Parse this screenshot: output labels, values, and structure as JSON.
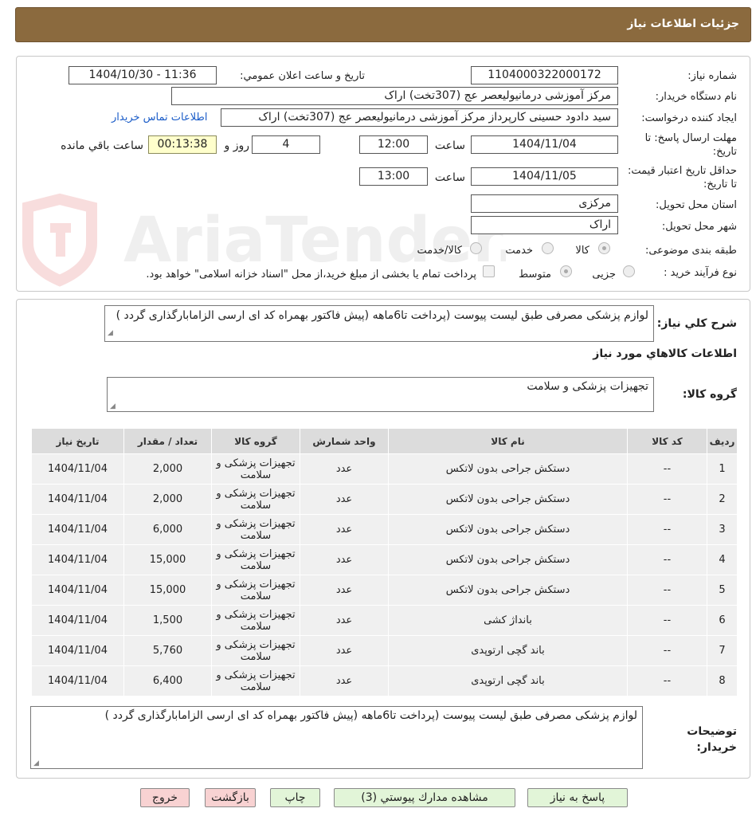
{
  "header": {
    "title": "جزئیات اطلاعات نیاز"
  },
  "form": {
    "need_number_label": "شماره نیاز:",
    "need_number": "1104000322000172",
    "announce_label": "تاریخ و ساعت اعلان عمومي:",
    "announce_value": "1404/10/30 - 11:36",
    "buyer_org_label": "نام دستگاه خریدار:",
    "buyer_org": "مرکز آموزشی درمانیولیعصر عج (307تخت) اراک",
    "requester_label": "ایجاد کننده درخواست:",
    "requester": "سید دادود حسینی کارپرداز مرکز آموزشی درمانیولیعصر عج (307تخت) اراک",
    "contact_link": "اطلاعات تماس خریدار",
    "deadline_label": "مهلت ارسال پاسخ: تا تاریخ:",
    "deadline_date": "1404/11/04",
    "time_label": "ساعت",
    "deadline_time": "12:00",
    "days_value": "4",
    "days_label": "روز و",
    "remaining_time": "00:13:38",
    "remaining_label": "ساعت باقي مانده",
    "validity_label": "حداقل تاریخ اعتبار قیمت: تا تاریخ:",
    "validity_date": "1404/11/05",
    "validity_time": "13:00",
    "province_label": "استان محل تحویل:",
    "province": "مرکزی",
    "city_label": "شهر محل تحویل:",
    "city": "اراک",
    "category_label": "طبقه بندی موضوعی:",
    "category_options": [
      "کالا",
      "خدمت",
      "کالا/خدمت"
    ],
    "process_label": "نوع فرآیند خرید :",
    "process_options": [
      "جزیی",
      "متوسط"
    ],
    "payment_note": "پرداخت تمام یا بخشی از مبلغ خرید،از محل \"اسناد خزانه اسلامی\" خواهد بود."
  },
  "details": {
    "summary_label": "شرح کلي نیاز:",
    "summary": "لوازم پزشکی مصرفی طبق لیست پیوست (پرداخت تا6ماهه (پیش فاکتور بهمراه کد ای ارسی الزامابارگذاری گردد )",
    "goods_info_title": "اطلاعات کالاهاي مورد نیاز",
    "goods_group_label": "گروه کالا:",
    "goods_group": "تجهیزات پزشکی و سلامت",
    "buyer_notes_label": "توضیحات خریدار:",
    "buyer_notes": "لوازم پزشکی مصرفی طبق لیست پیوست (پرداخت تا6ماهه (پیش فاکتور بهمراه کد ای ارسی الزامابارگذاری گردد )"
  },
  "table": {
    "columns": [
      "ردیف",
      "کد کالا",
      "نام کالا",
      "واحد شمارش",
      "گروه کالا",
      "تعداد / مقدار",
      "تاریخ نیاز"
    ],
    "rows": [
      [
        "1",
        "--",
        "دستکش جراحی بدون لاتکس",
        "عدد",
        "تجهیزات پزشکی و سلامت",
        "2,000",
        "1404/11/04"
      ],
      [
        "2",
        "--",
        "دستکش جراحی بدون لاتکس",
        "عدد",
        "تجهیزات پزشکی و سلامت",
        "2,000",
        "1404/11/04"
      ],
      [
        "3",
        "--",
        "دستکش جراحی بدون لاتکس",
        "عدد",
        "تجهیزات پزشکی و سلامت",
        "6,000",
        "1404/11/04"
      ],
      [
        "4",
        "--",
        "دستکش جراحی بدون لاتکس",
        "عدد",
        "تجهیزات پزشکی و سلامت",
        "15,000",
        "1404/11/04"
      ],
      [
        "5",
        "--",
        "دستکش جراحی بدون لاتکس",
        "عدد",
        "تجهیزات پزشکی و سلامت",
        "15,000",
        "1404/11/04"
      ],
      [
        "6",
        "--",
        "بانداژ کشی",
        "عدد",
        "تجهیزات پزشکی و سلامت",
        "1,500",
        "1404/11/04"
      ],
      [
        "7",
        "--",
        "باند گچی ارتوپدی",
        "عدد",
        "تجهیزات پزشکی و سلامت",
        "5,760",
        "1404/11/04"
      ],
      [
        "8",
        "--",
        "باند گچی ارتوپدی",
        "عدد",
        "تجهیزات پزشکی و سلامت",
        "6,400",
        "1404/11/04"
      ]
    ]
  },
  "buttons": {
    "reply": "پاسخ به نیاز",
    "attachments": "مشاهده مدارك پیوستي (3)",
    "print": "چاپ",
    "back": "بازگشت",
    "exit": "خروج"
  },
  "watermark": {
    "text": "AriaTender.net"
  }
}
